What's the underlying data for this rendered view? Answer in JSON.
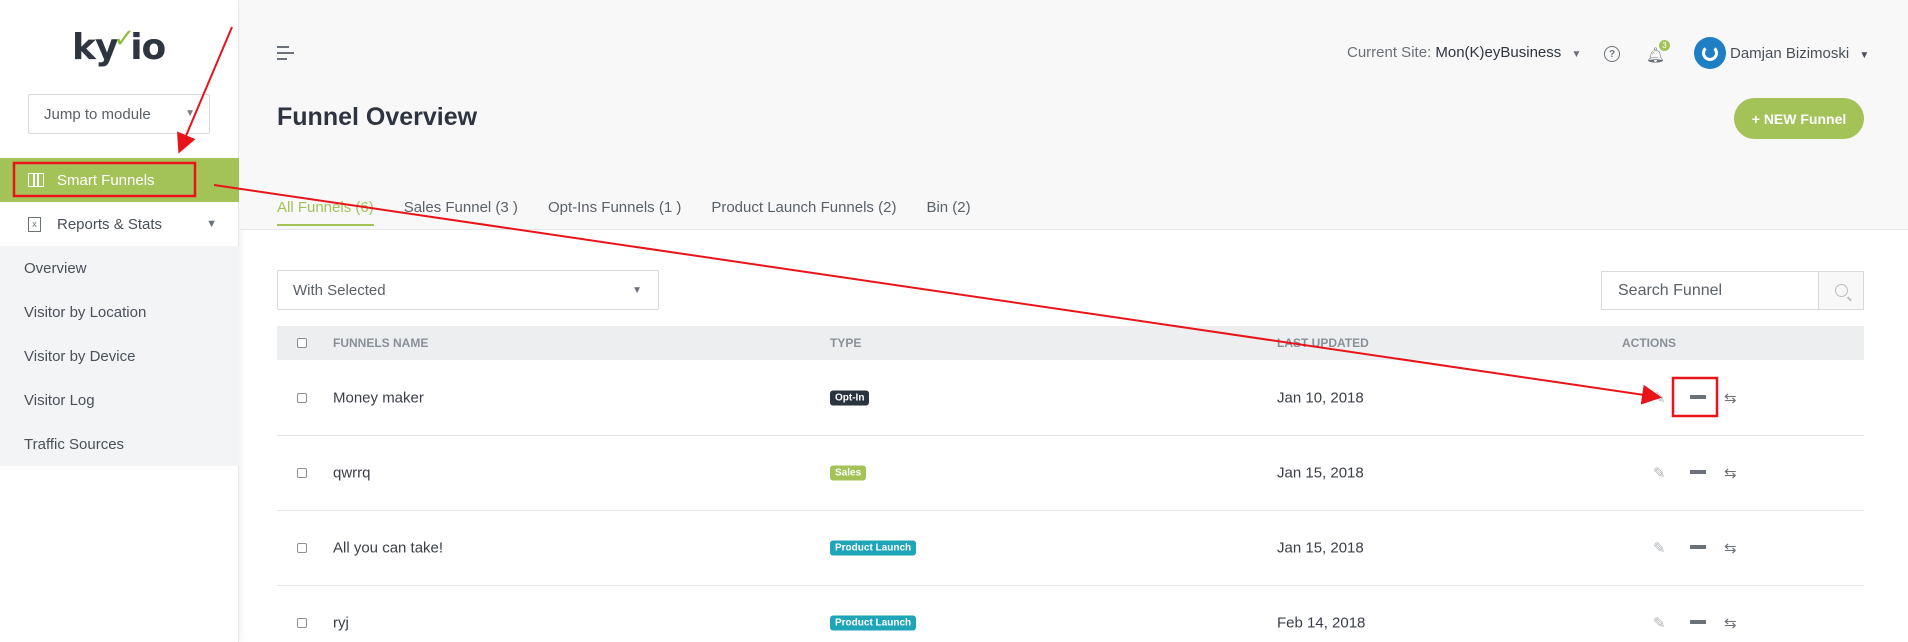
{
  "brand": {
    "logo_pre": "ky",
    "logo_mark": "✓",
    "logo_post": "io"
  },
  "sidebar": {
    "jump_placeholder": "Jump to module",
    "items": [
      {
        "label": "Smart Funnels",
        "active": true
      },
      {
        "label": "Reports & Stats",
        "active": false
      }
    ],
    "subitems": [
      {
        "label": "Overview"
      },
      {
        "label": "Visitor by Location"
      },
      {
        "label": "Visitor by Device"
      },
      {
        "label": "Visitor Log"
      },
      {
        "label": "Traffic Sources"
      }
    ]
  },
  "header": {
    "site_label": "Current Site:",
    "site_name": "Mon(K)eyBusiness",
    "notification_count": "3",
    "user_name": "Damjan Bizimoski"
  },
  "page": {
    "title": "Funnel Overview",
    "new_button": "+ NEW Funnel"
  },
  "tabs": [
    {
      "label": "All Funnels (6)",
      "active": true
    },
    {
      "label": "Sales Funnel (3 )",
      "active": false
    },
    {
      "label": "Opt-Ins Funnels (1 )",
      "active": false
    },
    {
      "label": "Product Launch Funnels (2)",
      "active": false
    },
    {
      "label": "Bin (2)",
      "active": false
    }
  ],
  "toolbar": {
    "bulk_action": "With Selected",
    "search_placeholder": "Search Funnel"
  },
  "table": {
    "columns": [
      "FUNNELS NAME",
      "TYPE",
      "LAST UPDATED",
      "ACTIONS"
    ],
    "rows": [
      {
        "name": "Money maker",
        "type": "Opt-In",
        "type_color": "#2a3340",
        "updated": "Jan 10, 2018"
      },
      {
        "name": "qwrrq",
        "type": "Sales",
        "type_color": "#a3c359",
        "updated": "Jan 15, 2018"
      },
      {
        "name": "All you can take!",
        "type": "Product Launch",
        "type_color": "#1fa5b8",
        "updated": "Jan 15, 2018"
      },
      {
        "name": "ryj",
        "type": "Product Launch",
        "type_color": "#1fa5b8",
        "updated": "Feb 14, 2018"
      }
    ]
  },
  "colors": {
    "accent": "#a3c359",
    "annotation": "#e8141a"
  },
  "icons": [
    "hamburger-icon",
    "help-icon",
    "bell-icon",
    "power-icon",
    "search-icon",
    "edit-icon",
    "archive-icon",
    "swap-icon"
  ]
}
